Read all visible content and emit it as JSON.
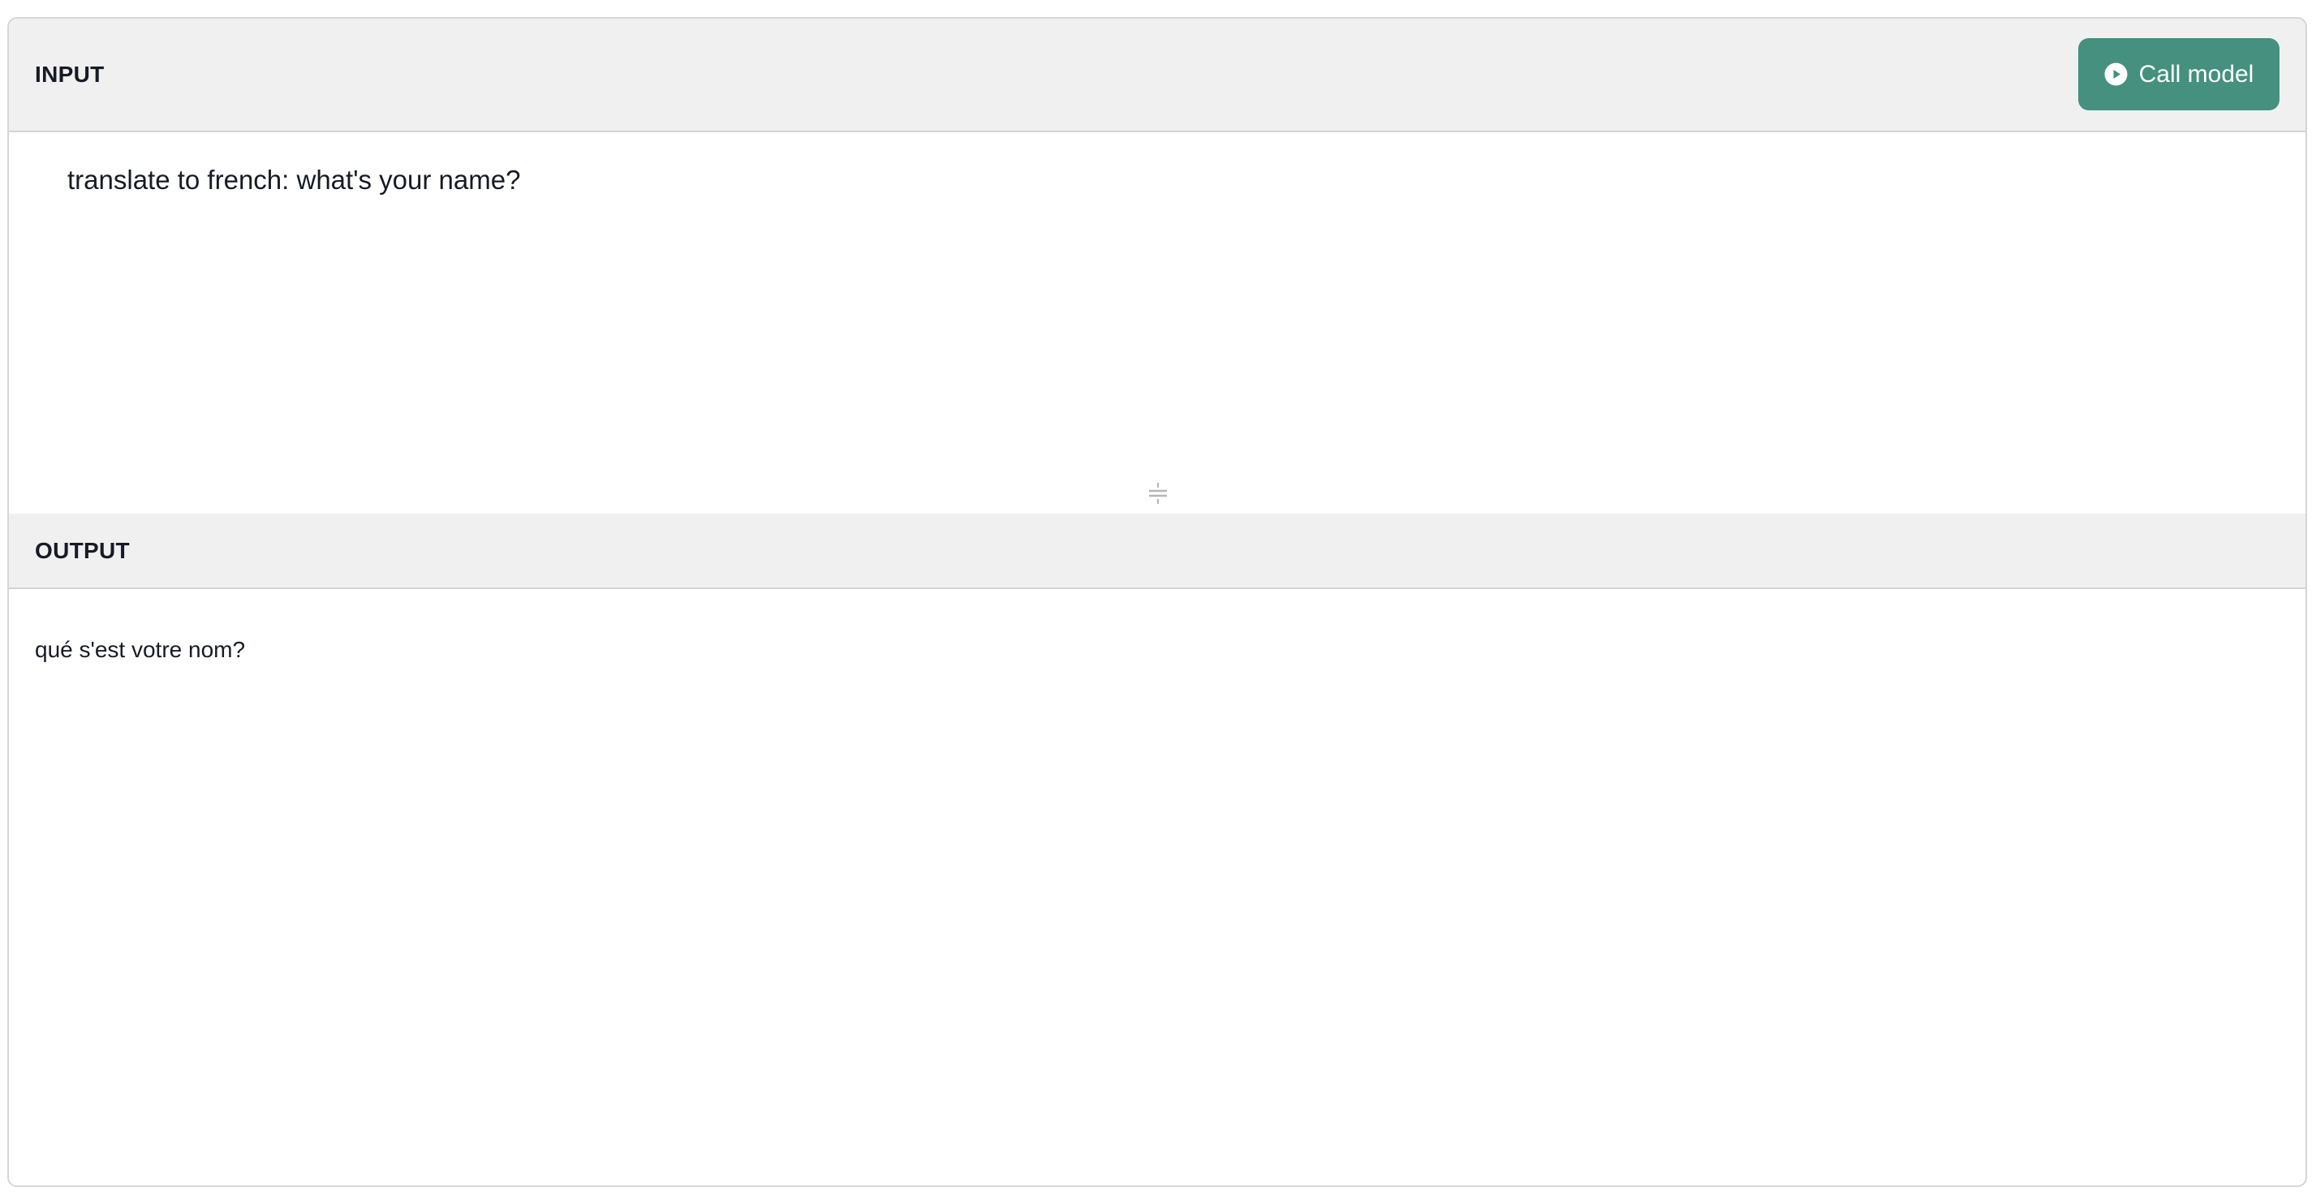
{
  "input_section": {
    "title": "INPUT",
    "call_button_label": "Call model",
    "text_value": "translate to french: what's your name?"
  },
  "output_section": {
    "title": "OUTPUT",
    "text_value": "qué s'est votre nom?"
  },
  "icons": {
    "call_button_icon": "play-circle-icon",
    "resize_handle_icon": "drag-handle-icon"
  },
  "colors": {
    "accent": "#45907f",
    "header_background": "#f0f0f0",
    "border": "#d6d6d6",
    "text": "#161b26"
  }
}
